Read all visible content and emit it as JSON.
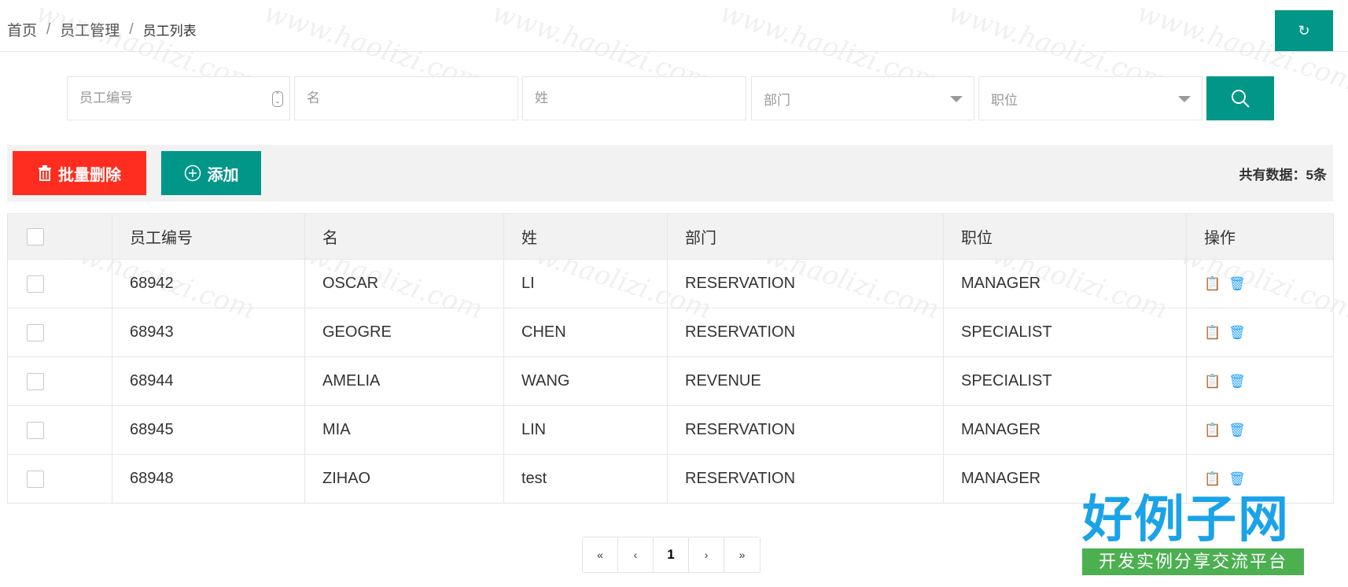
{
  "breadcrumb": {
    "home": "首页",
    "section": "员工管理",
    "current": "员工列表",
    "separator": "/"
  },
  "refresh_button": {
    "icon": "refresh-icon",
    "glyph": "↻"
  },
  "search": {
    "emp_id_placeholder": "员工编号",
    "first_name_placeholder": "名",
    "last_name_placeholder": "姓",
    "department_placeholder": "部门",
    "position_placeholder": "职位",
    "search_icon": "search-icon"
  },
  "toolbar": {
    "batch_delete_label": "批量删除",
    "add_label": "添加",
    "total_text": "共有数据：5条"
  },
  "table": {
    "columns": [
      "员工编号",
      "名",
      "姓",
      "部门",
      "职位",
      "操作"
    ],
    "rows": [
      {
        "id": "68942",
        "first": "OSCAR",
        "last": "LI",
        "dept": "RESERVATION",
        "position": "MANAGER"
      },
      {
        "id": "68943",
        "first": "GEOGRE",
        "last": "CHEN",
        "dept": "RESERVATION",
        "position": "SPECIALIST"
      },
      {
        "id": "68944",
        "first": "AMELIA",
        "last": "WANG",
        "dept": "REVENUE",
        "position": "SPECIALIST"
      },
      {
        "id": "68945",
        "first": "MIA",
        "last": "LIN",
        "dept": "RESERVATION",
        "position": "MANAGER"
      },
      {
        "id": "68948",
        "first": "ZIHAO",
        "last": "test",
        "dept": "RESERVATION",
        "position": "MANAGER"
      }
    ]
  },
  "pagination": {
    "first": "«",
    "prev": "‹",
    "current": "1",
    "next": "›",
    "last": "»"
  },
  "watermark": {
    "text": "www.haolizi.com",
    "logo_main": "好例子网",
    "logo_sub": "开发实例分享交流平台"
  },
  "colors": {
    "primary": "#009688",
    "danger": "#ff2d1f",
    "link_icon": "#1e9fff"
  }
}
